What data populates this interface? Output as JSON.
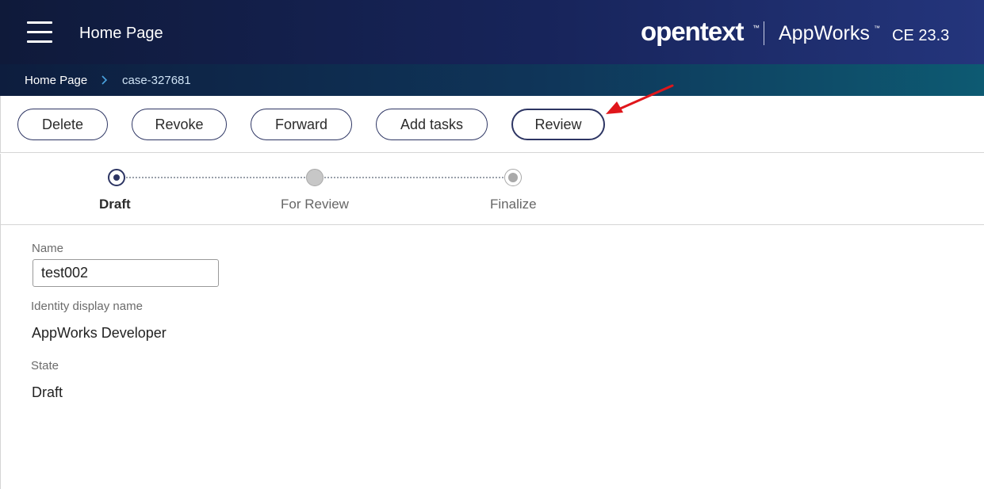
{
  "header": {
    "title": "Home Page",
    "brand": {
      "logo_text": "opentext",
      "trademark": "™",
      "product": "AppWorks",
      "version": "CE 23.3"
    },
    "menu_icon": "hamburger-menu-icon"
  },
  "breadcrumb": {
    "items": [
      "Home Page",
      "case-327681"
    ],
    "separator_icon": "chevron-right-icon"
  },
  "toolbar": {
    "buttons": [
      "Delete",
      "Revoke",
      "Forward",
      "Add tasks",
      "Review"
    ]
  },
  "stepper": {
    "steps": [
      {
        "label": "Draft",
        "status": "current"
      },
      {
        "label": "For Review",
        "status": "pending"
      },
      {
        "label": "Finalize",
        "status": "pending"
      }
    ]
  },
  "form": {
    "name": {
      "label": "Name",
      "value": "test002"
    },
    "identity": {
      "label": "Identity display name",
      "value": "AppWorks Developer"
    },
    "state": {
      "label": "State",
      "value": "Draft"
    }
  },
  "colors": {
    "header_bg": "#17245a",
    "breadcrumb_bg": "#0f3559",
    "accent": "#2d3563",
    "annotation_arrow": "#e0161b"
  }
}
